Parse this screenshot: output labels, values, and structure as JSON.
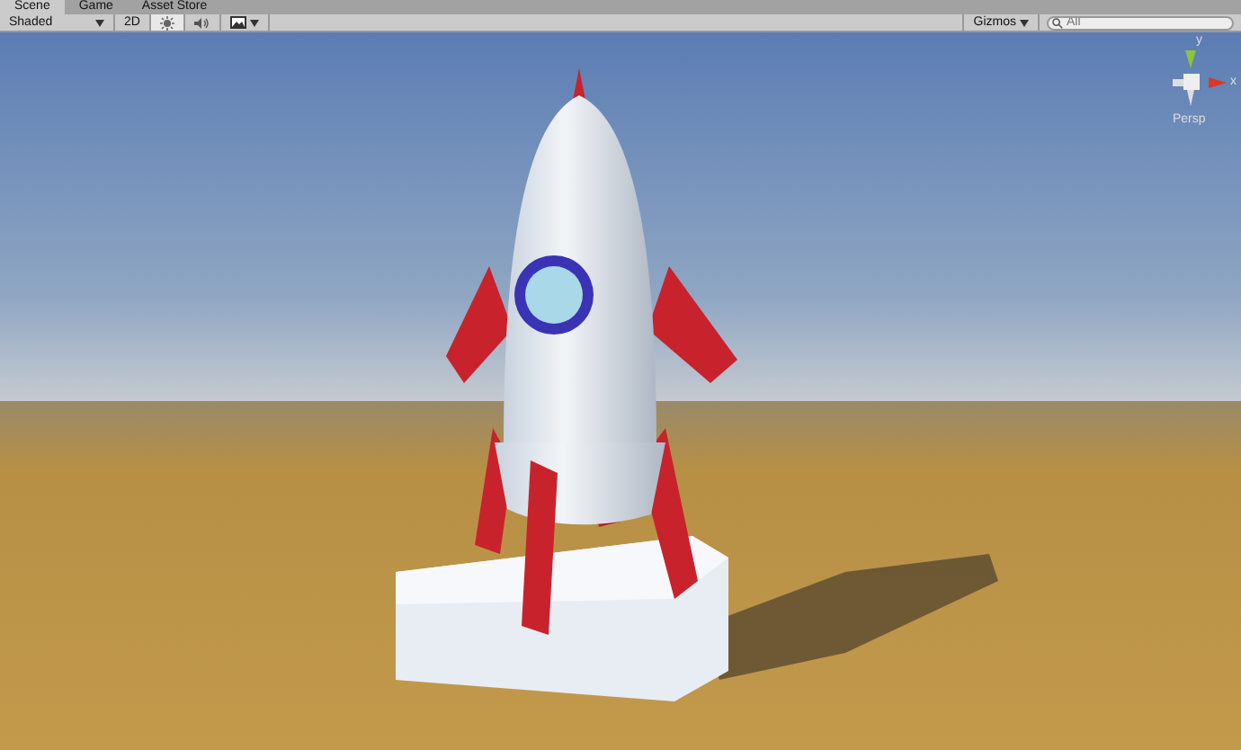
{
  "tabs": [
    {
      "label": "Scene",
      "selected": true
    },
    {
      "label": "Game",
      "selected": false
    },
    {
      "label": "Asset Store",
      "selected": false
    }
  ],
  "toolbar": {
    "shading_mode": "Shaded",
    "toggles": [
      {
        "kind": "text",
        "label": "2D",
        "on": false
      },
      {
        "kind": "light",
        "on": true
      },
      {
        "kind": "audio",
        "on": false
      },
      {
        "kind": "image",
        "on": false
      }
    ],
    "gizmos": "Gizmos",
    "search": {
      "placeholder": "All"
    }
  },
  "orientation_gizmo": {
    "y_label": "y",
    "x_label": "x",
    "projection": "Persp"
  }
}
